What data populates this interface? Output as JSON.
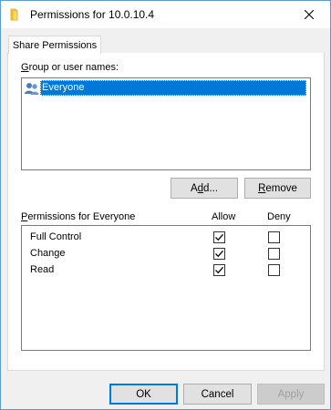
{
  "window": {
    "title": "Permissions for 10.0.10.4",
    "accent_color": "#0078d7"
  },
  "tabs": [
    {
      "label": "Share Permissions",
      "active": true
    }
  ],
  "group_section": {
    "label_mnemonic": "G",
    "label_rest": "roup or user names:",
    "users": [
      {
        "name": "Everyone",
        "icon": "users-group-icon",
        "selected": true
      }
    ],
    "add_button": {
      "pre": "A",
      "mnemonic": "d",
      "post": "d..."
    },
    "remove_button": {
      "mnemonic": "R",
      "post": "emove"
    }
  },
  "permissions_section": {
    "label_mnemonic": "P",
    "label_rest": "ermissions for Everyone",
    "allow_header": "Allow",
    "deny_header": "Deny",
    "rows": [
      {
        "name": "Full Control",
        "allow": true,
        "deny": false
      },
      {
        "name": "Change",
        "allow": true,
        "deny": false
      },
      {
        "name": "Read",
        "allow": true,
        "deny": false
      }
    ]
  },
  "footer": {
    "ok_label": "OK",
    "cancel_label": "Cancel",
    "apply_label": "Apply",
    "apply_enabled": false
  }
}
